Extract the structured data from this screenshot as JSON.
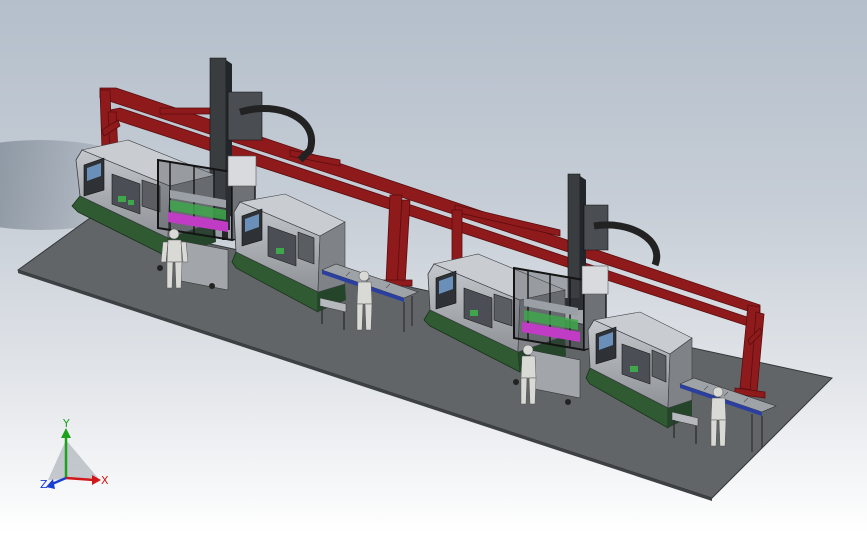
{
  "scene": {
    "description_hidden": "",
    "colors": {
      "floor": "#626568",
      "floor_edge": "#34373a",
      "frame_red": "#8e1a1c",
      "frame_red_dark": "#5c0d0e",
      "machine_gray": "#a9adb1",
      "machine_dark": "#3a3d40",
      "base_green": "#2f5a32",
      "cage_black": "#141414",
      "magenta": "#c13cc4",
      "green_part": "#3fa64b"
    }
  },
  "triad": {
    "x_label": "X",
    "y_label": "Y",
    "z_label": "Z",
    "x_color": "#d01818",
    "y_color": "#1ca21c",
    "z_color": "#1a3fd0"
  }
}
